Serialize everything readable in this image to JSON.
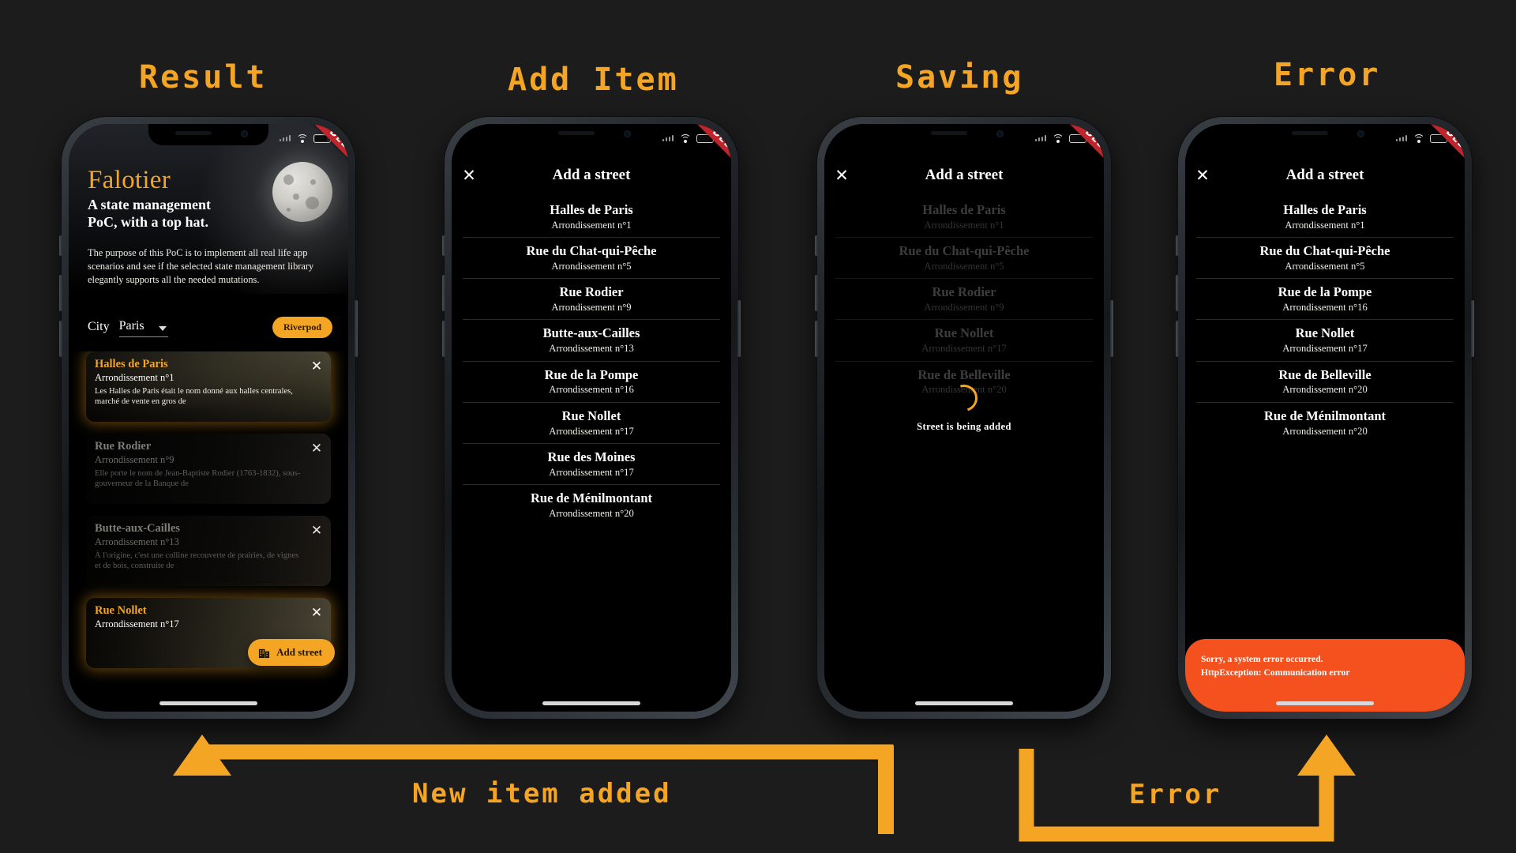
{
  "columns": [
    {
      "title": "Result"
    },
    {
      "title": "Add Item"
    },
    {
      "title": "Saving"
    },
    {
      "title": "Error"
    }
  ],
  "flow": {
    "new_item_label": "New item added",
    "error_label": "Error",
    "arrow_color": "#f5a524"
  },
  "status_bar": {
    "battery_icon": "battery-icon",
    "wifi_icon": "wifi-icon",
    "signal_icon": "signal-icon"
  },
  "ribbon": {
    "label": "DEBUG",
    "color": "#c0252b"
  },
  "result_screen": {
    "brand": "Falotier",
    "tagline": "A state management\nPoC, with a top hat.",
    "tagline_line1": "A state management",
    "tagline_line2": "PoC, with a top hat.",
    "blurb": "The purpose of this PoC is to implement all real life app scenarios and see if the selected state management library elegantly supports all the needed mutations.",
    "city_label": "City",
    "city_value": "Paris",
    "library_pill": "Riverpod",
    "fab_label": "Add street",
    "fab_icon": "building-icon",
    "close_icon": "close-icon",
    "cards": [
      {
        "title": "Halles de Paris",
        "arrondissement": "Arrondissement n°1",
        "description": "Les Halles de Paris était le nom donné aux halles centrales, marché de vente en gros de",
        "highlighted": true
      },
      {
        "title": "Rue Rodier",
        "arrondissement": "Arrondissement n°9",
        "description": "Elle porte le nom de Jean-Baptiste Rodier (1763-1832), sous-gouverneur de la Banque de",
        "highlighted": false
      },
      {
        "title": "Butte-aux-Cailles",
        "arrondissement": "Arrondissement n°13",
        "description": "À l'origine, c'est une colline recouverte de prairies, de vignes et de bois, construite de",
        "highlighted": false
      },
      {
        "title": "Rue Nollet",
        "arrondissement": "Arrondissement n°17",
        "description": "",
        "highlighted": true
      }
    ]
  },
  "add_item_screen": {
    "close_icon": "close-icon",
    "title": "Add a street",
    "streets": [
      {
        "name": "Halles de Paris",
        "arrondissement": "Arrondissement n°1"
      },
      {
        "name": "Rue du Chat-qui-Pêche",
        "arrondissement": "Arrondissement n°5"
      },
      {
        "name": "Rue Rodier",
        "arrondissement": "Arrondissement n°9"
      },
      {
        "name": "Butte-aux-Cailles",
        "arrondissement": "Arrondissement n°13"
      },
      {
        "name": "Rue de la Pompe",
        "arrondissement": "Arrondissement n°16"
      },
      {
        "name": "Rue Nollet",
        "arrondissement": "Arrondissement n°17"
      },
      {
        "name": "Rue des Moines",
        "arrondissement": "Arrondissement n°17"
      },
      {
        "name": "Rue de Ménilmontant",
        "arrondissement": "Arrondissement n°20"
      }
    ]
  },
  "saving_screen": {
    "close_icon": "close-icon",
    "title": "Add a street",
    "loading_text": "Street is being added",
    "spinner_color": "#f5a524",
    "streets": [
      {
        "name": "Halles de Paris",
        "arrondissement": "Arrondissement n°1"
      },
      {
        "name": "Rue du Chat-qui-Pêche",
        "arrondissement": "Arrondissement n°5"
      },
      {
        "name": "Rue Rodier",
        "arrondissement": "Arrondissement n°9"
      },
      {
        "name": "Rue Nollet",
        "arrondissement": "Arrondissement n°17"
      },
      {
        "name": "Rue de Belleville",
        "arrondissement": "Arrondissement n°20"
      }
    ]
  },
  "error_screen": {
    "close_icon": "close-icon",
    "title": "Add a street",
    "error_line1": "Sorry, a system error occurred.",
    "error_line2": "HttpException: Communication error",
    "error_color": "#f4511e",
    "streets": [
      {
        "name": "Halles de Paris",
        "arrondissement": "Arrondissement n°1"
      },
      {
        "name": "Rue du Chat-qui-Pêche",
        "arrondissement": "Arrondissement n°5"
      },
      {
        "name": "Rue de la Pompe",
        "arrondissement": "Arrondissement n°16"
      },
      {
        "name": "Rue Nollet",
        "arrondissement": "Arrondissement n°17"
      },
      {
        "name": "Rue de Belleville",
        "arrondissement": "Arrondissement n°20"
      },
      {
        "name": "Rue de Ménilmontant",
        "arrondissement": "Arrondissement n°20"
      }
    ]
  }
}
